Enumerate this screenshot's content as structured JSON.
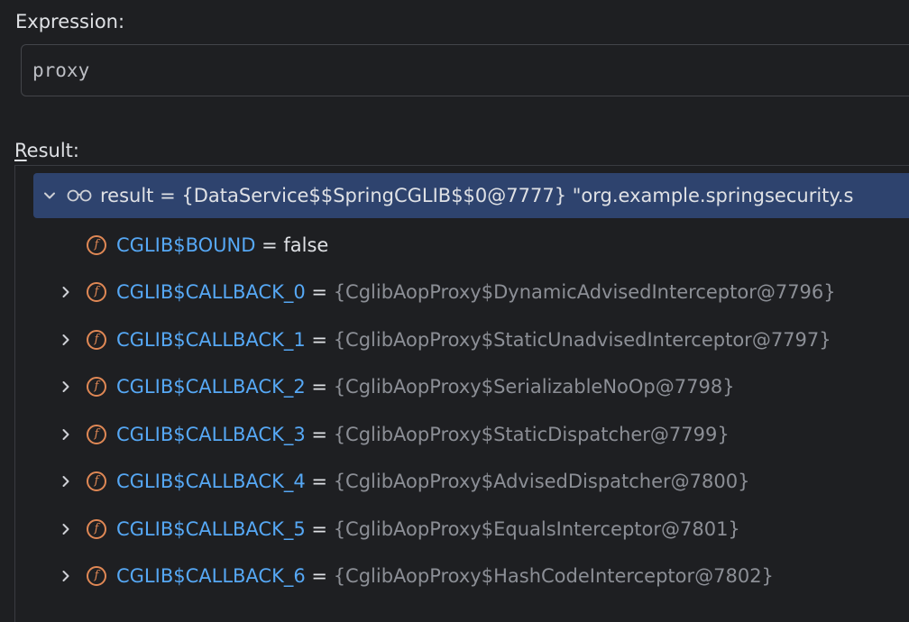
{
  "expression": {
    "label": "Expression:",
    "value": "proxy"
  },
  "result": {
    "label_mnemonic": "R",
    "label_rest": "esult:",
    "root": {
      "text": "result = {DataService$$SpringCGLIB$$0@7777} \"org.example.springsecurity.s",
      "icon": "watch-glasses-icon"
    },
    "children": [
      {
        "name": "CGLIB$BOUND",
        "eq": " = ",
        "value": "false",
        "expandable": false
      },
      {
        "name": "CGLIB$CALLBACK_0",
        "eq": " = ",
        "value": "{CglibAopProxy$DynamicAdvisedInterceptor@7796}",
        "expandable": true
      },
      {
        "name": "CGLIB$CALLBACK_1",
        "eq": " = ",
        "value": "{CglibAopProxy$StaticUnadvisedInterceptor@7797}",
        "expandable": true
      },
      {
        "name": "CGLIB$CALLBACK_2",
        "eq": " = ",
        "value": "{CglibAopProxy$SerializableNoOp@7798}",
        "expandable": true
      },
      {
        "name": "CGLIB$CALLBACK_3",
        "eq": " = ",
        "value": "{CglibAopProxy$StaticDispatcher@7799}",
        "expandable": true
      },
      {
        "name": "CGLIB$CALLBACK_4",
        "eq": " = ",
        "value": "{CglibAopProxy$AdvisedDispatcher@7800}",
        "expandable": true
      },
      {
        "name": "CGLIB$CALLBACK_5",
        "eq": " = ",
        "value": "{CglibAopProxy$EqualsInterceptor@7801}",
        "expandable": true
      },
      {
        "name": "CGLIB$CALLBACK_6",
        "eq": " = ",
        "value": "{CglibAopProxy$HashCodeInterceptor@7802}",
        "expandable": true
      }
    ],
    "field_icon_letter": "f"
  },
  "colors": {
    "background": "#1e1f22",
    "selection": "#2e436e",
    "focus_bar": "#548af7",
    "field_name": "#56a8f5",
    "field_icon": "#e08855",
    "object_value": "#8c8f96"
  }
}
